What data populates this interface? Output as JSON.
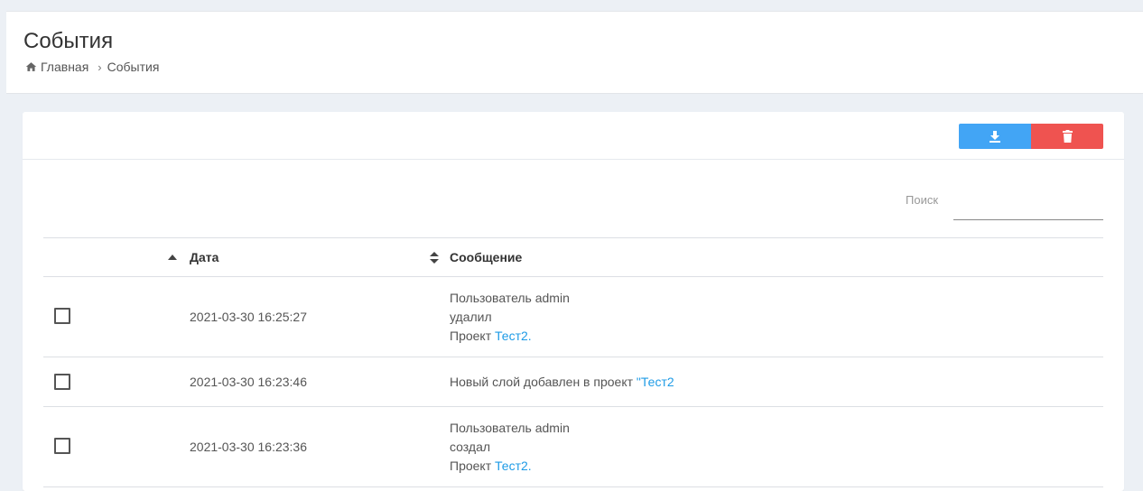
{
  "header": {
    "title": "События",
    "breadcrumb": {
      "home": "Главная",
      "current": "События"
    }
  },
  "toolbar": {
    "download_icon": "download-icon",
    "delete_icon": "trash-icon",
    "download_color": "#42a5f5",
    "delete_color": "#ef5350"
  },
  "search": {
    "label": "Поиск",
    "value": ""
  },
  "table": {
    "columns": {
      "date": "Дата",
      "message": "Сообщение"
    },
    "rows": [
      {
        "date": "2021-03-30 16:25:27",
        "line1": "Пользователь admin",
        "line2": "удалил",
        "line3_prefix": "Проект ",
        "link": "Тест2",
        "line3_suffix": "."
      },
      {
        "date": "2021-03-30 16:23:46",
        "text": "Новый слой добавлен в проект ",
        "link": "\"Тест2"
      },
      {
        "date": "2021-03-30 16:23:36",
        "line1": "Пользователь admin",
        "line2": "создал",
        "line3_prefix": "Проект ",
        "link": "Тест2",
        "line3_suffix": "."
      }
    ]
  }
}
